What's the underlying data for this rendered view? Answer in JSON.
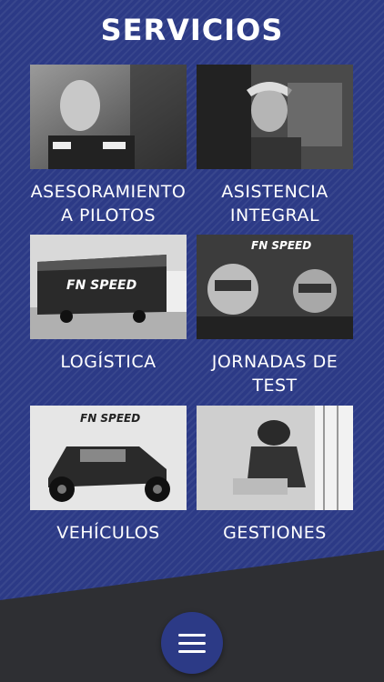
{
  "page": {
    "title": "SERVICIOS",
    "accent_color": "#2c3a86",
    "bottom_color": "#2e2f33"
  },
  "services": [
    {
      "label": "ASESORAMIENTO\nA PILOTOS",
      "photo": "driver-portrait"
    },
    {
      "label": "ASISTENCIA\nINTEGRAL",
      "photo": "mechanic-at-work"
    },
    {
      "label": "LOGÍSTICA",
      "photo": "fn-speed-truck"
    },
    {
      "label": "JORNADAS DE\nTEST",
      "photo": "drivers-in-cockpit"
    },
    {
      "label": "VEHÍCULOS",
      "photo": "off-road-buggy"
    },
    {
      "label": "GESTIONES",
      "photo": "navigator-with-roadbook"
    }
  ],
  "menu_button": {
    "icon": "hamburger-menu-icon"
  }
}
